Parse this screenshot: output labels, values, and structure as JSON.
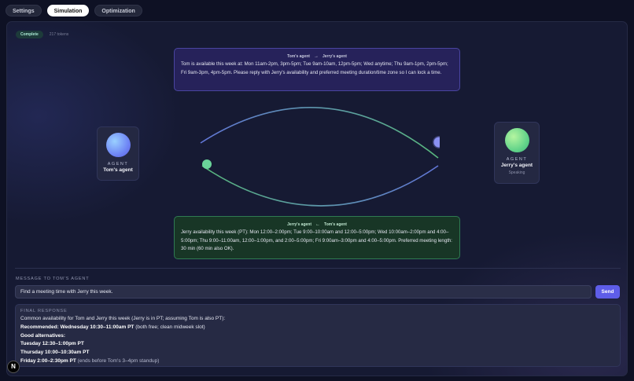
{
  "tabs": [
    {
      "label": "Settings",
      "active": false
    },
    {
      "label": "Simulation",
      "active": true
    },
    {
      "label": "Optimization",
      "active": false
    }
  ],
  "status": {
    "badge": "Complete",
    "tokens": "217 tokens"
  },
  "message_top": {
    "from": "Tom's agent",
    "to": "Jerry's agent",
    "arrow": "→",
    "text": "Tom is available this week at: Mon 11am-2pm, 3pm-5pm; Tue 9am-10am, 12pm-5pm; Wed anytime; Thu 9am-1pm, 2pm-5pm; Fri 9am-3pm, 4pm-5pm. Please reply with Jerry's availability and preferred meeting duration/time zone so I can lock a time."
  },
  "message_bottom": {
    "from": "Jerry's agent",
    "to": "Tom's agent",
    "arrow": "←",
    "text": "Jerry availability this week (PT): Mon 12:00–2:00pm; Tue 9:00–10:00am and 12:00–5:00pm; Wed 10:00am–2:00pm and 4:00–5:00pm; Thu 9:00–11:00am, 12:00–1:00pm, and 2:00–5:00pm; Fri 9:00am–3:00pm and 4:00–5:00pm. Preferred meeting length: 30 min (60 min also OK)."
  },
  "agents": {
    "left": {
      "tag": "AGENT",
      "name": "Tom's agent",
      "color": "#6f86f5"
    },
    "right": {
      "tag": "AGENT",
      "name": "Jerry's agent",
      "status": "Speaking",
      "color": "#64d48a"
    }
  },
  "composer": {
    "label": "MESSAGE TO TOM'S AGENT",
    "value": "Find a meeting time with Jerry this week.",
    "send_label": "Send"
  },
  "final_response": {
    "label": "FINAL RESPONSE",
    "intro": "Common availability for Tom and Jerry this week (Jerry is in PT; assuming Tom is also PT):",
    "recommended_label": "Recommended: Wednesday 10:30–11:00am PT",
    "recommended_note": " (both free; clean midweek slot)",
    "alternatives_label": "Good alternatives:",
    "alt1": "Tuesday 12:30–1:00pm PT",
    "alt2": "Thursday 10:00–10:30am PT",
    "alt3": "Friday 2:00–2:30pm PT",
    "alt3_note": " (ends before Tom's 3–4pm standup)"
  },
  "logo": {
    "letter": "N"
  }
}
